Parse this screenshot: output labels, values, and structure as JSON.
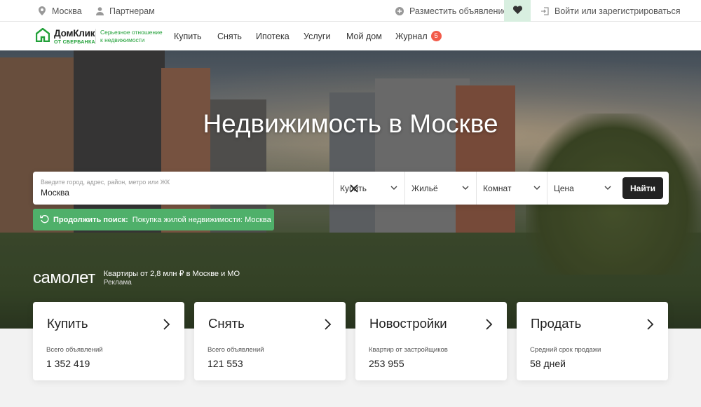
{
  "topbar": {
    "city": "Москва",
    "partners": "Партнерам",
    "post_ad": "Разместить объявление",
    "login": "Войти или зарегистрироваться"
  },
  "header": {
    "logo_name": "ДомКлик",
    "logo_sub": "ОТ СБЕРБАНКА",
    "slogan_line1": "Серьезное отношение",
    "slogan_line2": "к недвижимости",
    "nav": [
      {
        "label": "Купить"
      },
      {
        "label": "Снять"
      },
      {
        "label": "Ипотека"
      },
      {
        "label": "Услуги"
      },
      {
        "label": "Мой дом"
      },
      {
        "label": "Журнал",
        "badge": "5"
      }
    ]
  },
  "hero": {
    "title": "Недвижимость в Москве"
  },
  "search": {
    "placeholder": "Введите город, адрес, район, метро или ЖК",
    "value": "Москва",
    "deal_type": "Купить",
    "property_type": "Жильё",
    "rooms": "Комнат",
    "price": "Цена",
    "submit": "Найти"
  },
  "continue_search": {
    "label": "Продолжить поиск:",
    "query": "Покупка жилой недвижимости: Москва"
  },
  "ad": {
    "brand": "самолет",
    "text": "Квартиры от 2,8 млн ₽ в Москве и МО",
    "label": "Реклама"
  },
  "cards": [
    {
      "title": "Купить",
      "label": "Всего объявлений",
      "value": "1 352 419"
    },
    {
      "title": "Снять",
      "label": "Всего объявлений",
      "value": "121 553"
    },
    {
      "title": "Новостройки",
      "label": "Квартир от застройщиков",
      "value": "253 955"
    },
    {
      "title": "Продать",
      "label": "Средний срок продажи",
      "value": "58 дней"
    }
  ],
  "colors": {
    "brand_green": "#21a038",
    "continue_green": "#4fb06a",
    "badge_red": "#f25b4a",
    "dark_button": "#222222"
  }
}
